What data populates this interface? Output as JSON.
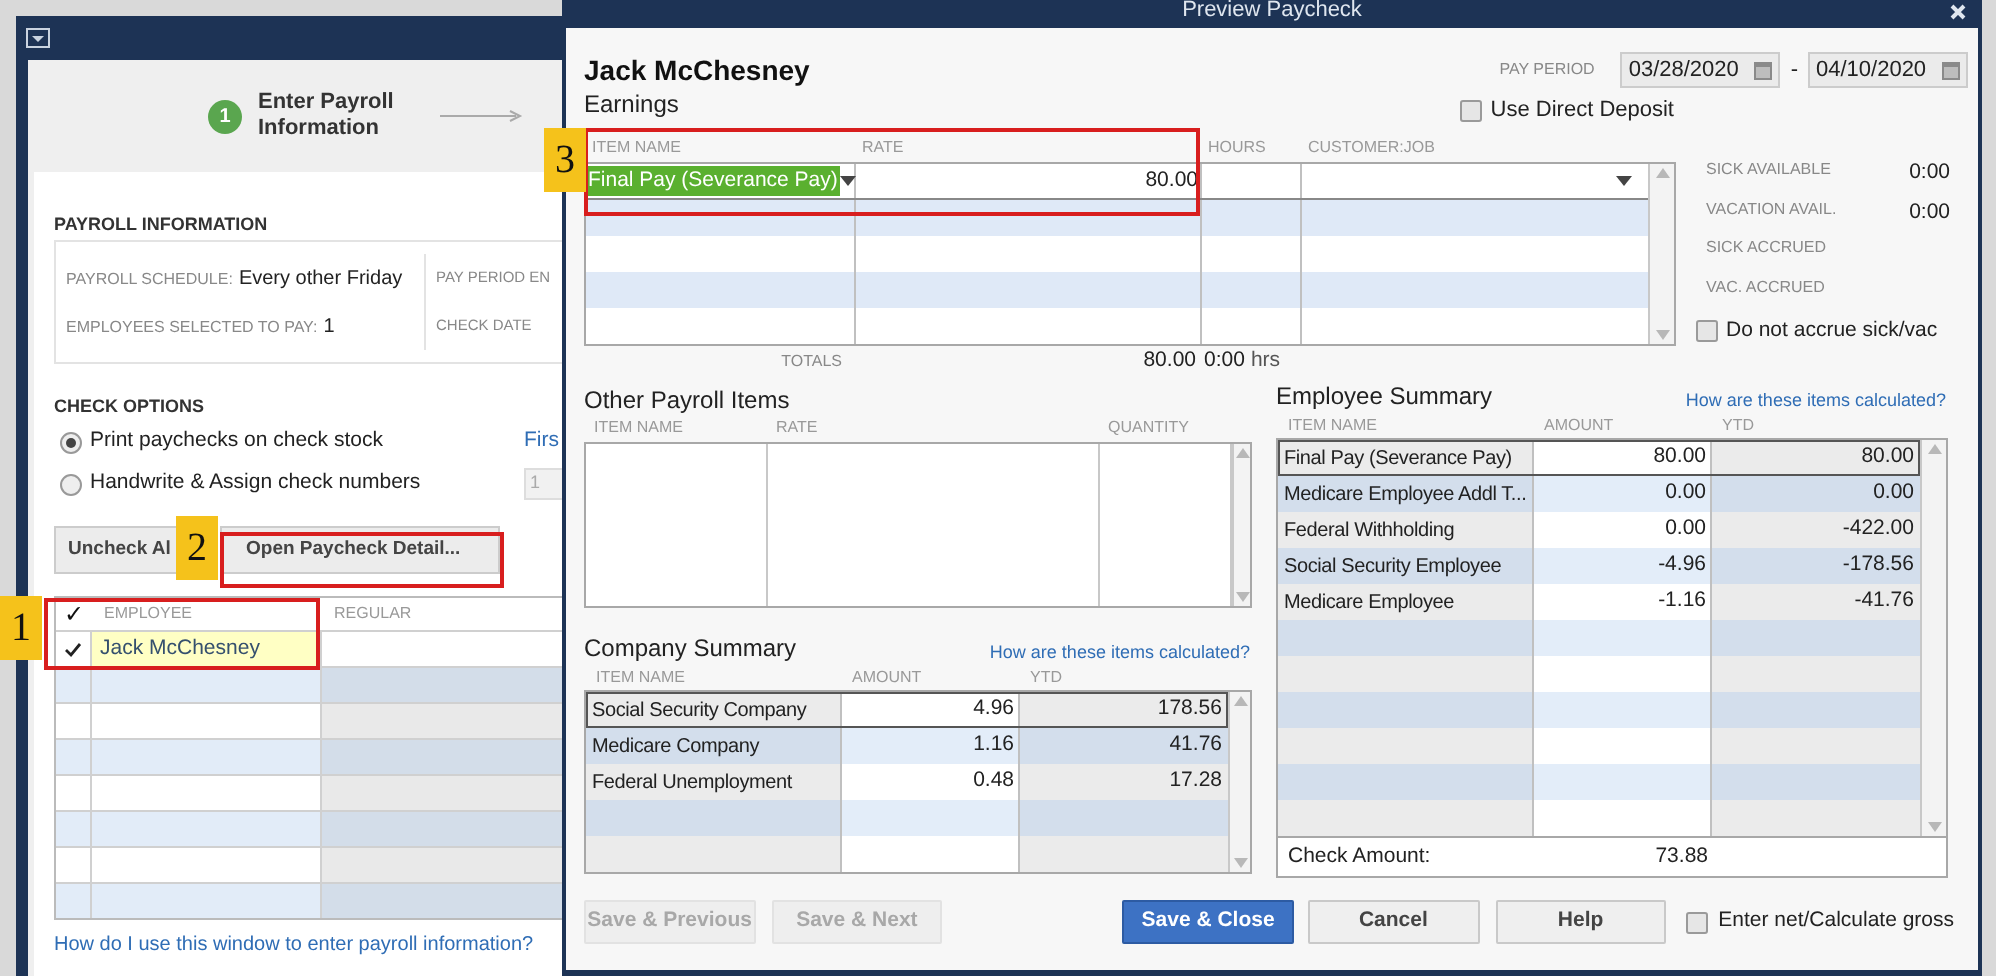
{
  "payroll_window": {
    "step": {
      "number": "1",
      "label": "Enter Payroll Information"
    },
    "payroll_information": {
      "heading": "PAYROLL INFORMATION",
      "schedule_label": "PAYROLL SCHEDULE:",
      "schedule": "Every other Friday",
      "employees_label": "EMPLOYEES SELECTED TO PAY:",
      "employees": "1",
      "pay_period_label": "PAY PERIOD EN",
      "check_date_label": "CHECK DATE"
    },
    "check_options": {
      "heading": "CHECK OPTIONS",
      "options": [
        {
          "label": "Print paychecks on check stock",
          "selected": true
        },
        {
          "label": "Handwrite & Assign check numbers",
          "selected": false
        }
      ],
      "first_link": "Firs",
      "check_number": "1"
    },
    "buttons": [
      "Uncheck Al",
      "Open Paycheck Detail..."
    ],
    "table": {
      "check_header": "✓",
      "columns": [
        "EMPLOYEE",
        "REGULAR"
      ],
      "rows": [
        {
          "checked": true,
          "employee": "Jack McChesney",
          "highlighted": true
        }
      ]
    },
    "help_link": "How do I use this window to enter payroll information?"
  },
  "callouts": [
    {
      "number": "1"
    },
    {
      "number": "2"
    },
    {
      "number": "3"
    }
  ],
  "paycheck_dialog": {
    "title": "Preview Paycheck",
    "employee": "Jack McChesney",
    "pay_period": {
      "label": "PAY PERIOD",
      "from": "03/28/2020",
      "separator": "-",
      "to": "04/10/2020"
    },
    "direct_deposit": {
      "label": "Use Direct Deposit",
      "checked": false
    },
    "earnings": {
      "title": "Earnings",
      "columns": [
        "ITEM NAME",
        "RATE",
        "HOURS",
        "CUSTOMER:JOB"
      ],
      "rows": [
        {
          "item": "Final Pay (Severance Pay)",
          "rate": "80.00",
          "selected": true
        }
      ],
      "totals": {
        "label": "TOTALS",
        "rate": "80.00",
        "hours": "0:00",
        "unit": "hrs"
      }
    },
    "accruals": [
      {
        "label": "SICK AVAILABLE",
        "value": "0:00"
      },
      {
        "label": "VACATION AVAIL.",
        "value": "0:00"
      },
      {
        "label": "SICK ACCRUED"
      },
      {
        "label": "VAC. ACCRUED"
      }
    ],
    "do_not_accrue": {
      "label": "Do not accrue sick/vac",
      "checked": false
    },
    "other_payroll_items": {
      "title": "Other Payroll Items",
      "columns": [
        "ITEM NAME",
        "RATE",
        "QUANTITY"
      ]
    },
    "company_summary": {
      "title": "Company Summary",
      "link": "How are these items calculated?",
      "columns": [
        "ITEM NAME",
        "AMOUNT",
        "YTD"
      ],
      "rows": [
        {
          "name": "Social Security Company",
          "amount": "4.96",
          "ytd": "178.56",
          "selected": true
        },
        {
          "name": "Medicare Company",
          "amount": "1.16",
          "ytd": "41.76",
          "selected": false
        },
        {
          "name": "Federal Unemployment",
          "amount": "0.48",
          "ytd": "17.28",
          "selected": false
        }
      ]
    },
    "employee_summary": {
      "title": "Employee Summary",
      "link": "How are these items calculated?",
      "columns": [
        "ITEM NAME",
        "AMOUNT",
        "YTD"
      ],
      "rows": [
        {
          "name": "Final Pay (Severance Pay)",
          "amount": "80.00",
          "ytd": "80.00",
          "selected": true
        },
        {
          "name": "Medicare Employee Addl T...",
          "amount": "0.00",
          "ytd": "0.00",
          "selected": false
        },
        {
          "name": "Federal Withholding",
          "amount": "0.00",
          "ytd": "-422.00",
          "selected": false
        },
        {
          "name": "Social Security Employee",
          "amount": "-4.96",
          "ytd": "-178.56",
          "selected": false
        },
        {
          "name": "Medicare Employee",
          "amount": "-1.16",
          "ytd": "-41.76",
          "selected": false
        }
      ],
      "check_amount_label": "Check Amount:",
      "check_amount": "73.88"
    },
    "buttons": [
      {
        "label": "Save & Previous",
        "kind": "normal",
        "disabled": true
      },
      {
        "label": "Save & Next",
        "kind": "normal",
        "disabled": true
      },
      {
        "label": "Save & Close",
        "kind": "primary",
        "disabled": false
      },
      {
        "label": "Cancel",
        "kind": "normal",
        "disabled": false
      },
      {
        "label": "Help",
        "kind": "normal",
        "disabled": false
      }
    ],
    "enter_net": {
      "label": "Enter net/Calculate gross",
      "checked": false
    }
  }
}
